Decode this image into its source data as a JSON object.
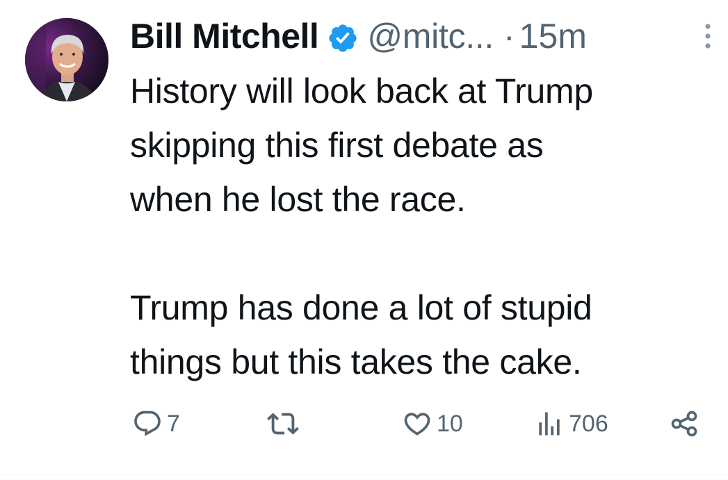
{
  "tweet": {
    "author": {
      "display_name": "Bill Mitchell",
      "handle": "@mitc...",
      "verified": true
    },
    "separator": "·",
    "time_ago": "15m",
    "paragraph_1": "History will look back at Trump skipping this first debate as when he lost the race.",
    "paragraph_2": "Trump has done a lot of stupid things but this takes the cake.",
    "lines_1": [
      "History will look back at Trump",
      "skipping this first debate as",
      "when he lost the race."
    ],
    "lines_2": [
      "Trump has done a lot of stupid",
      "things but this takes the cake."
    ],
    "stats": {
      "replies": "7",
      "retweets": "",
      "likes": "10",
      "views": "706"
    }
  },
  "colors": {
    "text": "#0f1419",
    "secondary": "#536471",
    "verified_badge": "#1d9bf0"
  },
  "icons": [
    "avatar",
    "verified-badge-icon",
    "more-icon",
    "reply-icon",
    "retweet-icon",
    "like-icon",
    "views-icon",
    "share-icon"
  ]
}
